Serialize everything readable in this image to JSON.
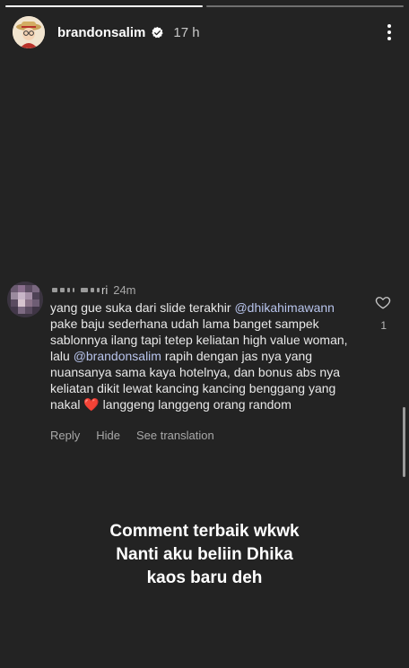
{
  "story": {
    "segments_total": 2,
    "segments_done": 1
  },
  "header": {
    "username": "brandonsalim",
    "time": "17 h",
    "icons": {
      "verified": "verified-badge-icon",
      "more": "more-vertical-icon"
    }
  },
  "comment": {
    "author_visible": "ri",
    "time": "24m",
    "text_parts": [
      {
        "text": "yang gue suka dari slide terakhir ",
        "mention": false
      },
      {
        "text": "@dhikahimawann",
        "mention": true
      },
      {
        "text": " pake baju sederhana udah lama banget sampek sablonnya ilang tapi tetep keliatan high value woman, lalu ",
        "mention": false
      },
      {
        "text": "@brandonsalim",
        "mention": true
      },
      {
        "text": " rapih dengan jas nya yang nuansanya sama kaya hotelnya, dan bonus abs nya keliatan dikit lewat kancing kancing benggang yang nakal ",
        "mention": false
      },
      {
        "text": "❤️",
        "mention": false,
        "emoji": true
      },
      {
        "text": " langgeng langgeng orang random",
        "mention": false
      }
    ],
    "like_count": "1",
    "actions": {
      "reply": "Reply",
      "hide": "Hide",
      "see_translation": "See translation"
    },
    "icons": {
      "like": "heart-outline-icon"
    }
  },
  "caption": {
    "lines": [
      "Comment terbaik wkwk",
      "Nanti aku beliin Dhika",
      "kaos baru deh"
    ]
  },
  "colors": {
    "background": "#232323",
    "mention": "#b8c4ec",
    "secondary_text": "#a8a8a8"
  }
}
